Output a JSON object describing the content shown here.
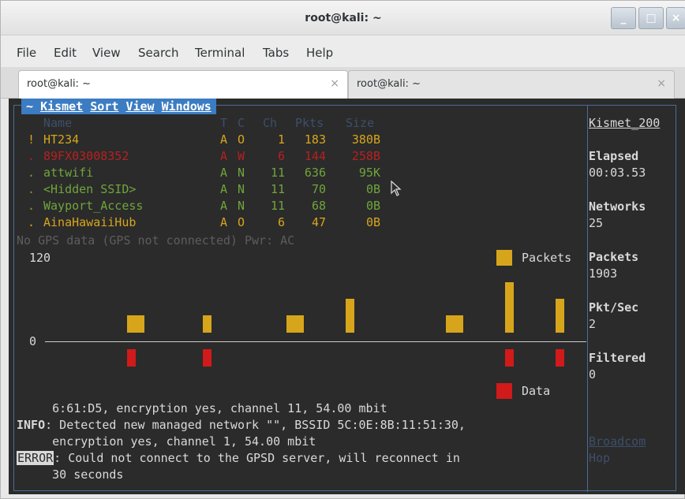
{
  "window": {
    "title": "root@kali: ~",
    "buttons": [
      "_",
      "□",
      "×"
    ]
  },
  "menubar": [
    "File",
    "Edit",
    "View",
    "Search",
    "Terminal",
    "Tabs",
    "Help"
  ],
  "tabs": [
    {
      "label": "root@kali: ~",
      "close": "×"
    },
    {
      "label": "root@kali: ~",
      "close": "×"
    }
  ],
  "kismet": {
    "menu": {
      "prefix": "~",
      "items": [
        "Kismet",
        "Sort",
        "View",
        "Windows"
      ]
    },
    "columns": {
      "name": "Name",
      "t": "T",
      "c": "C",
      "ch": "Ch",
      "pkts": "Pkts",
      "size": "Size"
    },
    "networks": [
      {
        "flag": "!",
        "name": "HT234",
        "t": "A",
        "c": "O",
        "ch": "1",
        "pkts": "183",
        "size": "380B",
        "color": "#d7a51c"
      },
      {
        "flag": ".",
        "name": "89FX03008352",
        "t": "A",
        "c": "W",
        "ch": "6",
        "pkts": "144",
        "size": "258B",
        "color": "#b82020"
      },
      {
        "flag": ".",
        "name": "attwifi",
        "t": "A",
        "c": "N",
        "ch": "11",
        "pkts": "636",
        "size": "95K",
        "color": "#6fa53a"
      },
      {
        "flag": ".",
        "name": "<Hidden SSID>",
        "t": "A",
        "c": "N",
        "ch": "11",
        "pkts": "70",
        "size": "0B",
        "color": "#6fa53a"
      },
      {
        "flag": ".",
        "name": "Wayport_Access",
        "t": "A",
        "c": "N",
        "ch": "11",
        "pkts": "68",
        "size": "0B",
        "color": "#6fa53a"
      },
      {
        "flag": ".",
        "name": "AinaHawaiiHub",
        "t": "A",
        "c": "O",
        "ch": "6",
        "pkts": "47",
        "size": "0B",
        "color": "#d7a51c"
      }
    ],
    "gps_status": "No GPS data (GPS not connected) Pwr: AC",
    "graph": {
      "y_max": "120",
      "y_min": "0",
      "legend_packets": "Packets",
      "legend_data": "Data",
      "packets_color": "#d7a51c",
      "data_color": "#d11a1a"
    },
    "sidebar": {
      "title": "Kismet_200",
      "elapsed_label": "Elapsed",
      "elapsed_value": "00:03.53",
      "networks_label": "Networks",
      "networks_value": "25",
      "packets_label": "Packets",
      "packets_value": "1903",
      "pktsec_label": "Pkt/Sec",
      "pktsec_value": "2",
      "filtered_label": "Filtered",
      "filtered_value": "0",
      "source_name": "Broadcom",
      "source_state": "Hop"
    },
    "log": {
      "line1": "     6:61:D5, encryption yes, channel 11, 54.00 mbit",
      "info_tag": "INFO",
      "line2": ": Detected new managed network \"\", BSSID 5C:0E:8B:11:51:30,",
      "line3": "     encryption yes, channel 1, 54.00 mbit",
      "error_tag": "ERROR",
      "line4": ": Could not connect to the GPSD server, will reconnect in",
      "line5": "     30 seconds"
    }
  }
}
